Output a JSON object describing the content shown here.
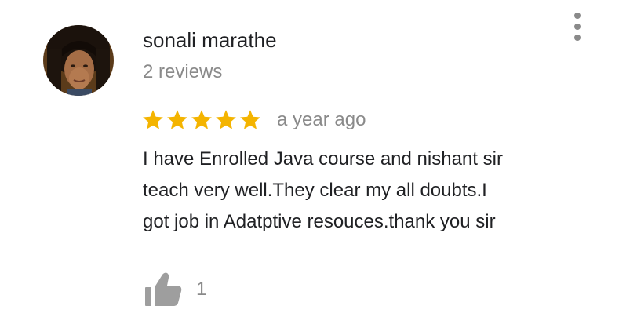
{
  "review": {
    "reviewer_name": "sonali marathe",
    "review_count": "2 reviews",
    "rating": 5,
    "rating_max": 5,
    "date": "a year ago",
    "text_lines": [
      "I have Enrolled Java course and nishant sir",
      "teach very well.They clear my all doubts.I",
      "got job in Adatptive resouces.thank you sir"
    ],
    "helpful_count": "1"
  },
  "colors": {
    "star": "#F4B400",
    "secondary_text": "#8a8a8a",
    "primary_text": "#202124",
    "icon": "#9e9e9e"
  },
  "icons": {
    "more": "more-vert-icon",
    "star": "star-icon",
    "helpful": "thumb-up-icon"
  }
}
